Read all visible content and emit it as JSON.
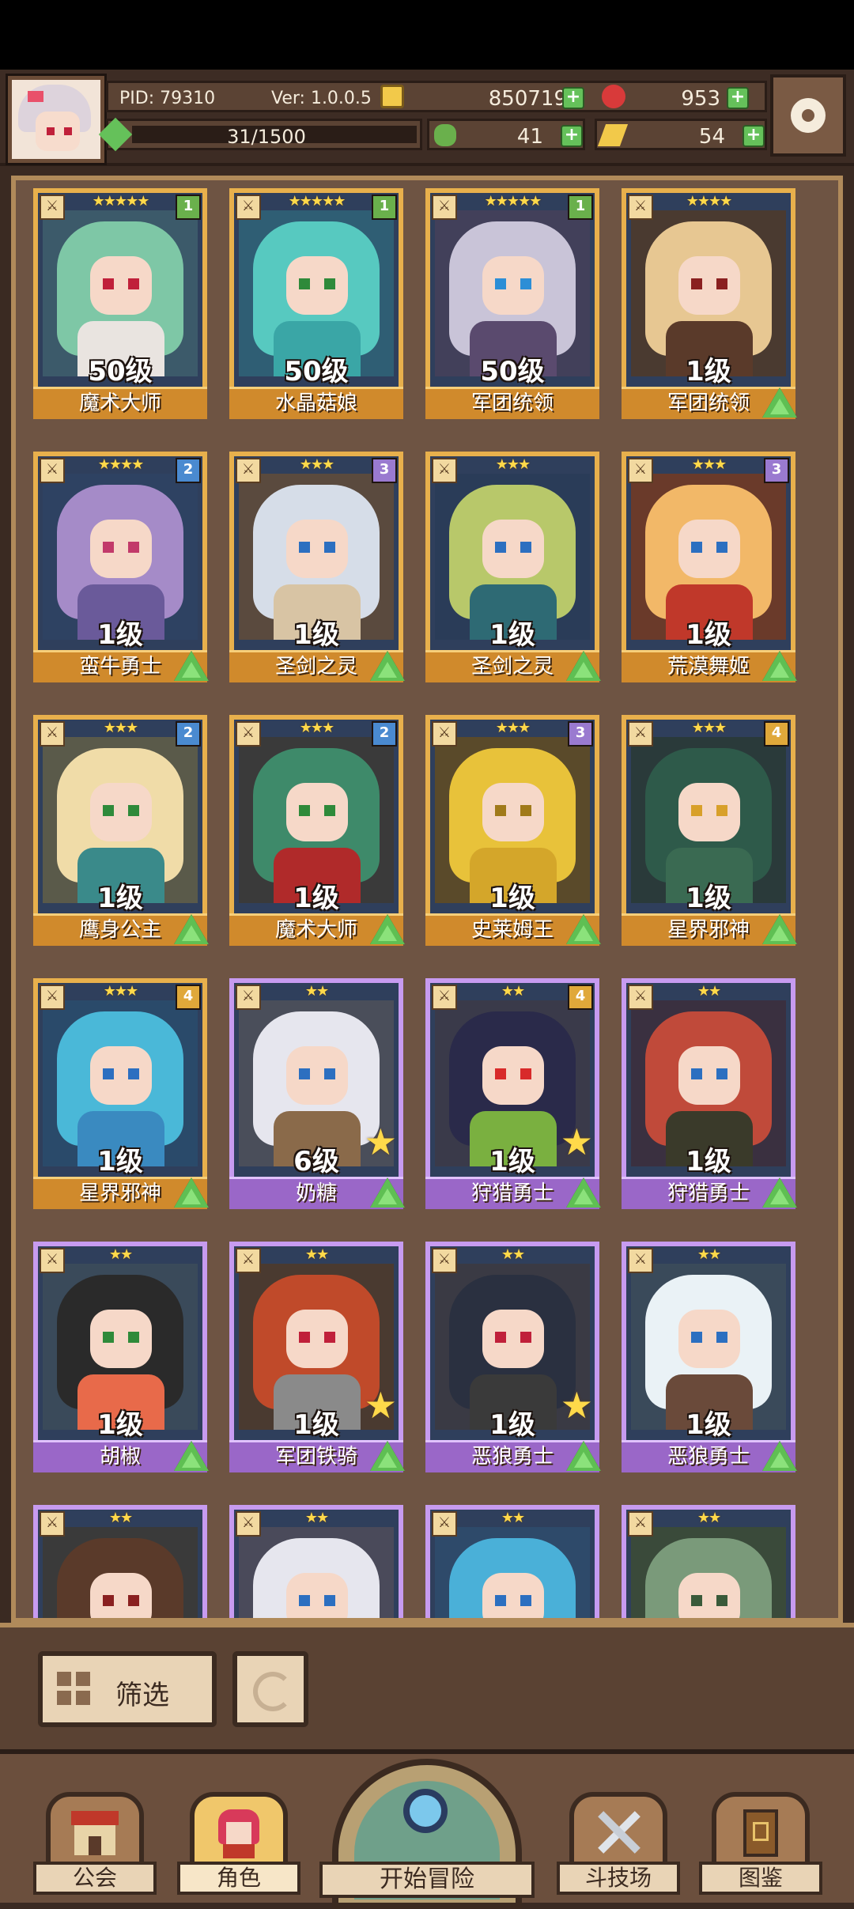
{
  "hud": {
    "pid": "PID: 79310",
    "version": "Ver: 1.0.0.5",
    "exp": "31/1500",
    "gold": "850719",
    "gems": "953",
    "clover": "41",
    "key": "54"
  },
  "cards": [
    {
      "level": "50级",
      "name": "魔术大师",
      "stars": "★★★★★",
      "rank": "1",
      "frame": "gold",
      "hair": "#7ec7a6",
      "body": "#e9e4e0",
      "eye": "#c0203a",
      "bg": "#3c5a6a",
      "up": false
    },
    {
      "level": "50级",
      "name": "水晶菇娘",
      "stars": "★★★★★",
      "rank": "1",
      "frame": "gold",
      "hair": "#57c9c0",
      "body": "#3aa6a6",
      "eye": "#2f8a3a",
      "bg": "#2f5e74",
      "up": false
    },
    {
      "level": "50级",
      "name": "军团统领",
      "stars": "★★★★★",
      "rank": "1",
      "frame": "gold",
      "hair": "#c9c4d8",
      "body": "#5a4a6e",
      "eye": "#2c8ed6",
      "bg": "#42405a",
      "up": false
    },
    {
      "level": "1级",
      "name": "军团统领",
      "stars": "★★★★",
      "rank": "",
      "frame": "gold",
      "hair": "#e7c792",
      "body": "#5a3a2a",
      "eye": "#8a2020",
      "bg": "#4a3a30",
      "up": true
    },
    {
      "level": "1级",
      "name": "蛮牛勇士",
      "stars": "★★★★",
      "rank": "2",
      "frame": "gold",
      "hair": "#a58bc8",
      "body": "#6a5a9a",
      "eye": "#c23a6a",
      "bg": "#2e4262",
      "up": true
    },
    {
      "level": "1级",
      "name": "圣剑之灵",
      "stars": "★★★",
      "rank": "3",
      "frame": "gold",
      "hair": "#d6dde8",
      "body": "#d8c4a4",
      "eye": "#2c6fc0",
      "bg": "#5a4a3e",
      "up": true
    },
    {
      "level": "1级",
      "name": "圣剑之灵",
      "stars": "★★★",
      "rank": "",
      "frame": "gold",
      "hair": "#b8c86a",
      "body": "#2e6a74",
      "eye": "#2c6fc0",
      "bg": "#2a3c58",
      "up": true
    },
    {
      "level": "1级",
      "name": "荒漠舞姬",
      "stars": "★★★",
      "rank": "3",
      "frame": "gold",
      "hair": "#f2b868",
      "body": "#c0382a",
      "eye": "#2c6fc0",
      "bg": "#6a3a2a",
      "up": true
    },
    {
      "level": "1级",
      "name": "鹰身公主",
      "stars": "★★★",
      "rank": "2",
      "frame": "gold",
      "hair": "#f0dca8",
      "body": "#3a8a8a",
      "eye": "#2f8a3a",
      "bg": "#5a5a4a",
      "up": true
    },
    {
      "level": "1级",
      "name": "魔术大师",
      "stars": "★★★",
      "rank": "2",
      "frame": "gold",
      "hair": "#3e8a6a",
      "body": "#b02a2a",
      "eye": "#2f8a3a",
      "bg": "#3a3a3a",
      "up": true
    },
    {
      "level": "1级",
      "name": "史莱姆王",
      "stars": "★★★",
      "rank": "3",
      "frame": "gold",
      "hair": "#e8c23a",
      "body": "#d4a62a",
      "eye": "#a07a1a",
      "bg": "#5a4a2a",
      "up": true
    },
    {
      "level": "1级",
      "name": "星界邪神",
      "stars": "★★★",
      "rank": "4",
      "frame": "gold",
      "hair": "#2e5a4a",
      "body": "#3a6a52",
      "eye": "#d8a02a",
      "bg": "#2a3a3a",
      "up": true
    },
    {
      "level": "1级",
      "name": "星界邪神",
      "stars": "★★★",
      "rank": "4",
      "frame": "gold",
      "hair": "#4ab8d8",
      "body": "#3a8ac0",
      "eye": "#2c6fc0",
      "bg": "#2a4a6a",
      "up": true
    },
    {
      "level": "6级",
      "name": "奶糖",
      "stars": "★★",
      "rank": "",
      "frame": "purple",
      "hair": "#e6e6ee",
      "body": "#8a6a4a",
      "eye": "#2c6fc0",
      "bg": "#4a4e5a",
      "up": true,
      "star": true
    },
    {
      "level": "1级",
      "name": "狩猎勇士",
      "stars": "★★",
      "rank": "4",
      "frame": "purple",
      "hair": "#2a2a4a",
      "body": "#7ab040",
      "eye": "#d82a2a",
      "bg": "#3a3a4a",
      "up": true,
      "star": true
    },
    {
      "level": "1级",
      "name": "狩猎勇士",
      "stars": "★★",
      "rank": "",
      "frame": "purple",
      "hair": "#c04a3a",
      "body": "#3a3a2a",
      "eye": "#2c6fc0",
      "bg": "#3a3040",
      "up": true
    },
    {
      "level": "1级",
      "name": "胡椒",
      "stars": "★★",
      "rank": "",
      "frame": "purple",
      "hair": "#2a2a2a",
      "body": "#e86a4a",
      "eye": "#2f8a3a",
      "bg": "#3a4a5a",
      "up": true
    },
    {
      "level": "1级",
      "name": "军团铁骑",
      "stars": "★★",
      "rank": "",
      "frame": "purple",
      "hair": "#c04a2a",
      "body": "#8a8a8a",
      "eye": "#c0203a",
      "bg": "#4a3a30",
      "up": true,
      "star": true
    },
    {
      "level": "1级",
      "name": "恶狼勇士",
      "stars": "★★",
      "rank": "",
      "frame": "purple",
      "hair": "#2a3040",
      "body": "#3a3a3a",
      "eye": "#c0203a",
      "bg": "#3a3a44",
      "up": true,
      "star": true
    },
    {
      "level": "1级",
      "name": "恶狼勇士",
      "stars": "★★",
      "rank": "",
      "frame": "purple",
      "hair": "#eaf2f6",
      "body": "#6a4a3a",
      "eye": "#2c6fc0",
      "bg": "#3a4a5a",
      "up": true
    },
    {
      "level": "",
      "name": "",
      "stars": "★★",
      "rank": "",
      "frame": "purple",
      "hair": "#5a3a2a",
      "body": "#8a5a3a",
      "eye": "#8a2020",
      "bg": "#3a3a3a",
      "up": false
    },
    {
      "level": "",
      "name": "",
      "stars": "★★",
      "rank": "",
      "frame": "purple",
      "hair": "#e6e6ee",
      "body": "#8a8a9a",
      "eye": "#2c6fc0",
      "bg": "#4a4a5a",
      "up": false
    },
    {
      "level": "",
      "name": "",
      "stars": "★★",
      "rank": "",
      "frame": "purple",
      "hair": "#4ab0d8",
      "body": "#3a7aa0",
      "eye": "#2c6fc0",
      "bg": "#2e4a6a",
      "up": false
    },
    {
      "level": "",
      "name": "",
      "stars": "★★",
      "rank": "",
      "frame": "purple",
      "hair": "#7a9a7a",
      "body": "#5a7a5a",
      "eye": "#3a5a3a",
      "bg": "#3a4a3a",
      "up": false
    }
  ],
  "rank_colors": {
    "1": "#6ab04c",
    "2": "#4a8ad0",
    "3": "#9a7ad0",
    "4": "#e0a83a"
  },
  "filter": {
    "label": "筛选"
  },
  "nav": {
    "guild": "公会",
    "character": "角色",
    "adventure": "开始冒险",
    "arena": "斗技场",
    "codex": "图鉴"
  }
}
